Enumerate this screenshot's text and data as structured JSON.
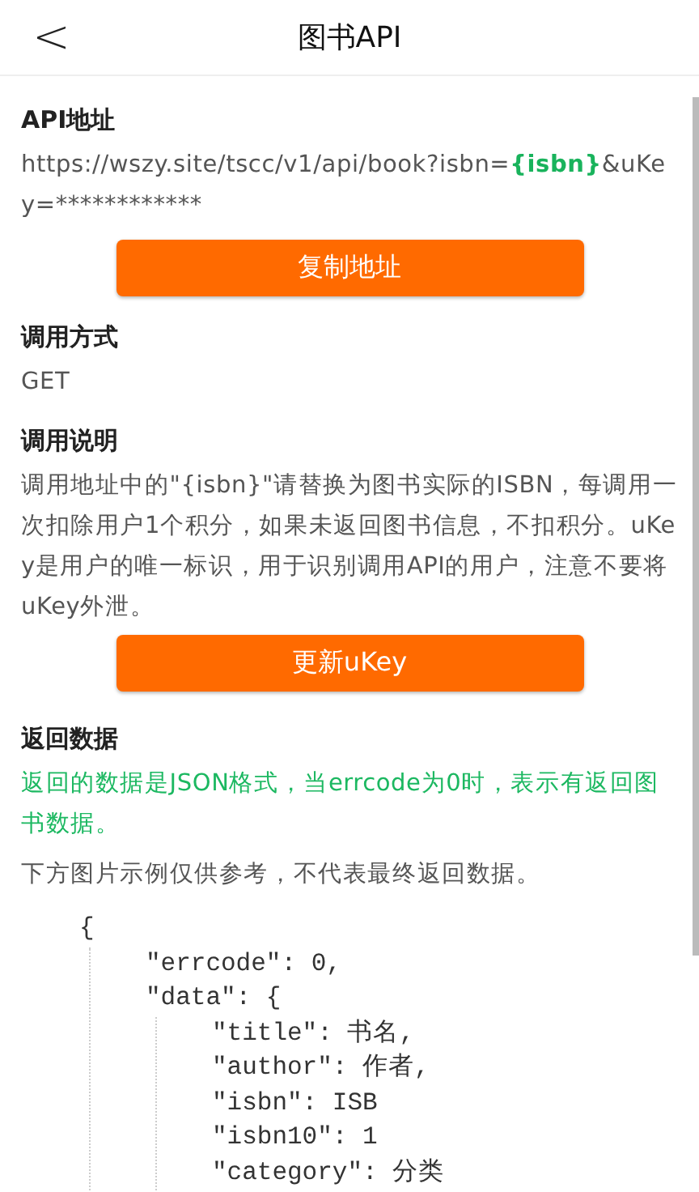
{
  "header": {
    "back": "<",
    "title": "图书API"
  },
  "address": {
    "heading": "API地址",
    "url_parts": [
      {
        "kind": "plain",
        "text": "https://wszy.site/tscc/v1/api/book?isbn="
      },
      {
        "kind": "param",
        "text": "{isbn}"
      },
      {
        "kind": "plain",
        "text": "&uKey=************"
      }
    ],
    "button": "复制地址"
  },
  "method": {
    "heading": "调用方式",
    "value": "GET"
  },
  "usage": {
    "heading": "调用说明",
    "text": "调用地址中的\"{isbn}\"请替换为图书实际的ISBN，每调用一次扣除用户1个积分，如果未返回图书信息，不扣积分。uKey是用户的唯一标识，用于识别调用API的用户，注意不要将uKey外泄。",
    "button": "更新uKey"
  },
  "response": {
    "heading": "返回数据",
    "note": "返回的数据是JSON格式，当errcode为0时，表示有返回图书数据。",
    "hint": "下方图片示例仅供参考，不代表最终返回数据。",
    "code": [
      {
        "text": "{",
        "children": [
          {
            "text": "\"errcode\": 0,"
          },
          {
            "text": "\"data\": {",
            "children": [
              {
                "text": "\"title\": 书名,"
              },
              {
                "text": "\"author\": 作者,"
              },
              {
                "text": "\"isbn\": ISB"
              },
              {
                "text": "\"isbn10\": 1"
              },
              {
                "text": "\"category\": 分类"
              }
            ]
          }
        ]
      }
    ]
  }
}
